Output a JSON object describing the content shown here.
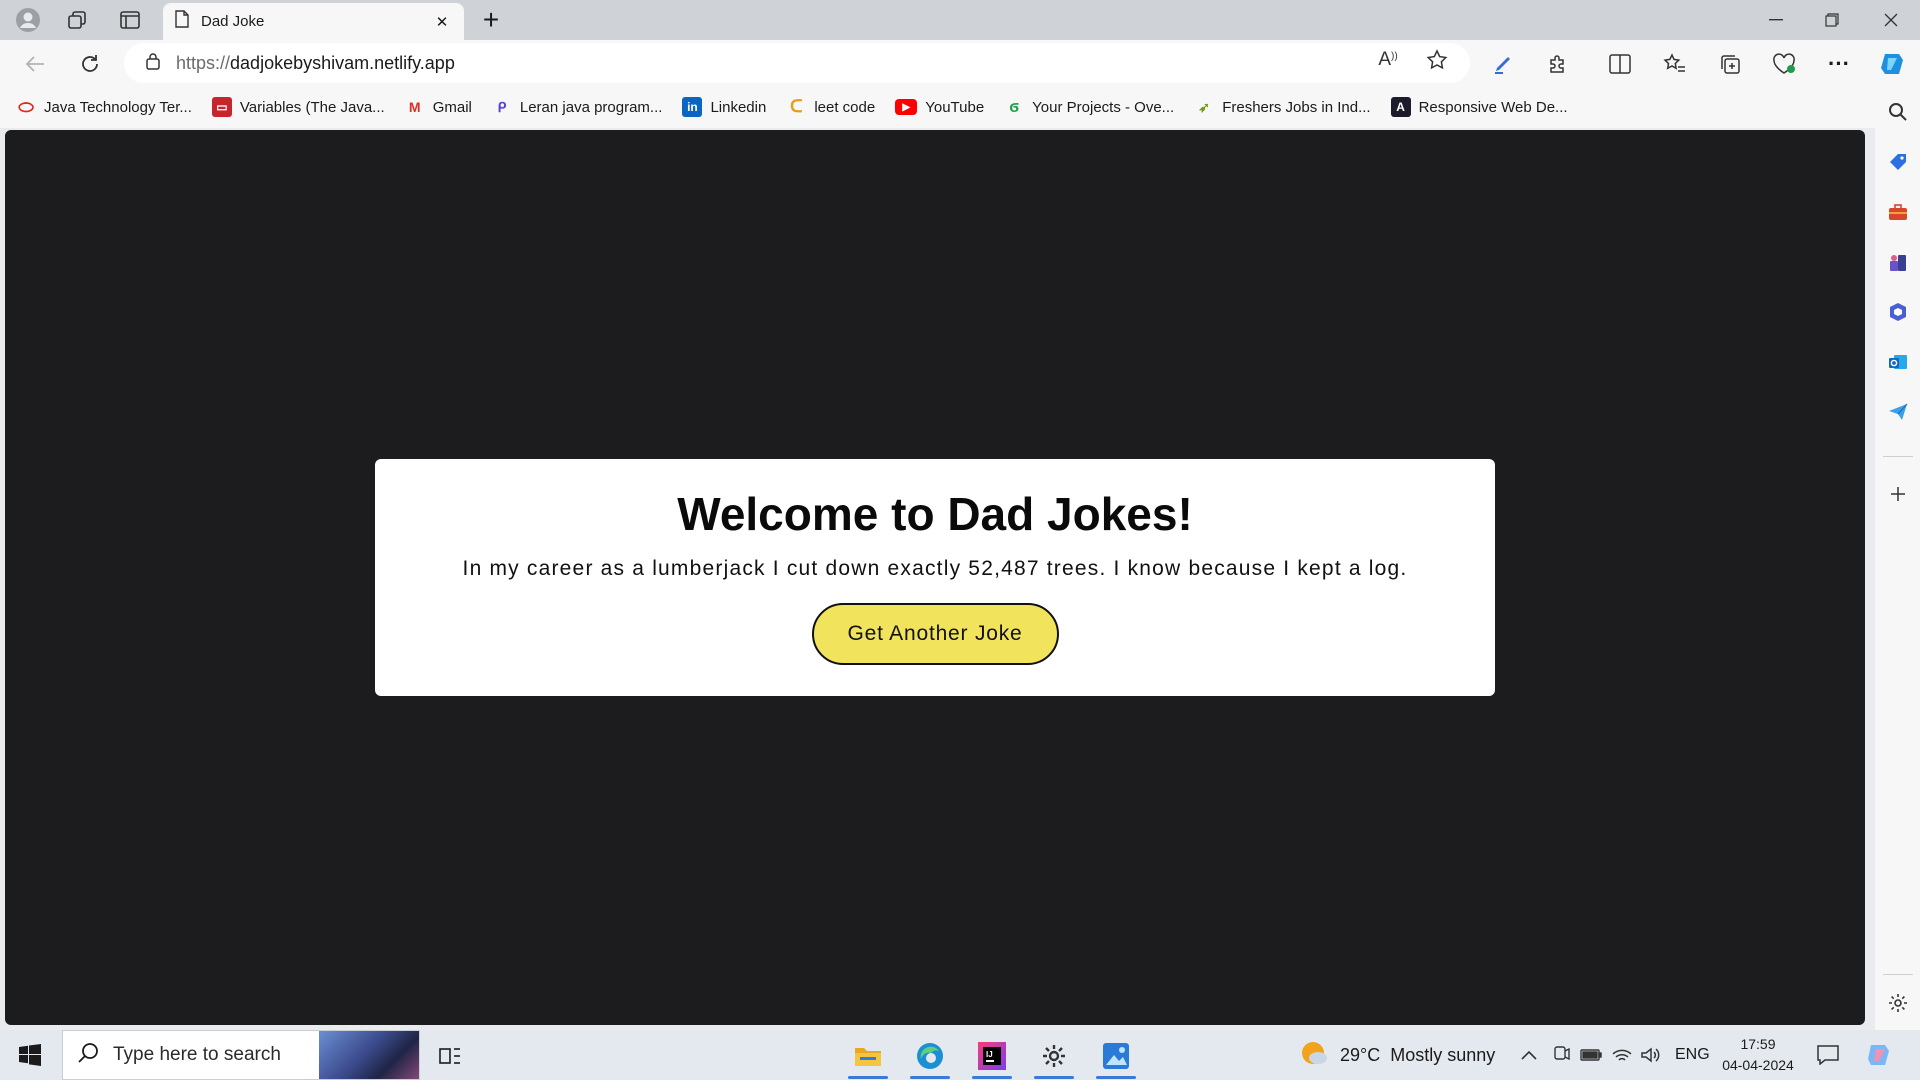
{
  "browser": {
    "tab_title": "Dad Joke",
    "url_scheme": "https://",
    "url_host": "dadjokebyshivam.netlify.app",
    "read_aloud_label": "A",
    "tab_close_glyph": "✕",
    "new_tab_glyph": "+"
  },
  "bookmarks": [
    {
      "label": "Java Technology Ter...",
      "icon": "oracle-icon",
      "color": "#e1251b",
      "glyph": "⬭"
    },
    {
      "label": "Variables (The Java...",
      "icon": "oracle-icon",
      "color": "#c5252b",
      "glyph": "▭"
    },
    {
      "label": "Gmail",
      "icon": "gmail-icon",
      "color": "#d93025",
      "glyph": "M"
    },
    {
      "label": "Leran java program...",
      "icon": "bookmark-icon",
      "color": "#5b3fd6",
      "glyph": "ᑭ"
    },
    {
      "label": "Linkedin",
      "icon": "linkedin-icon",
      "color": "#0a66c2",
      "glyph": "in"
    },
    {
      "label": "leet code",
      "icon": "leetcode-icon",
      "color": "#1b1b1b",
      "glyph": "C"
    },
    {
      "label": "YouTube",
      "icon": "youtube-icon",
      "color": "#ff0000",
      "glyph": "▶"
    },
    {
      "label": "Your Projects - Ove...",
      "icon": "projects-icon",
      "color": "#22a04b",
      "glyph": "ϭ"
    },
    {
      "label": "Freshers Jobs in Ind...",
      "icon": "jobs-icon",
      "color": "#7a9a1d",
      "glyph": "➶"
    },
    {
      "label": "Responsive Web De...",
      "icon": "web-icon",
      "color": "#1b1b2b",
      "glyph": "A"
    }
  ],
  "page": {
    "heading": "Welcome to Dad Jokes!",
    "joke": "In my career as a lumberjack I cut down exactly 52,487 trees. I know because I kept a log.",
    "button_label": "Get Another Joke",
    "background_color": "#1c1c1e",
    "button_color": "#f2e35d"
  },
  "taskbar": {
    "search_placeholder": "Type here to search",
    "weather_temp": "29°C",
    "weather_text": "Mostly sunny",
    "language": "ENG",
    "time": "17:59",
    "date": "04-04-2024"
  }
}
